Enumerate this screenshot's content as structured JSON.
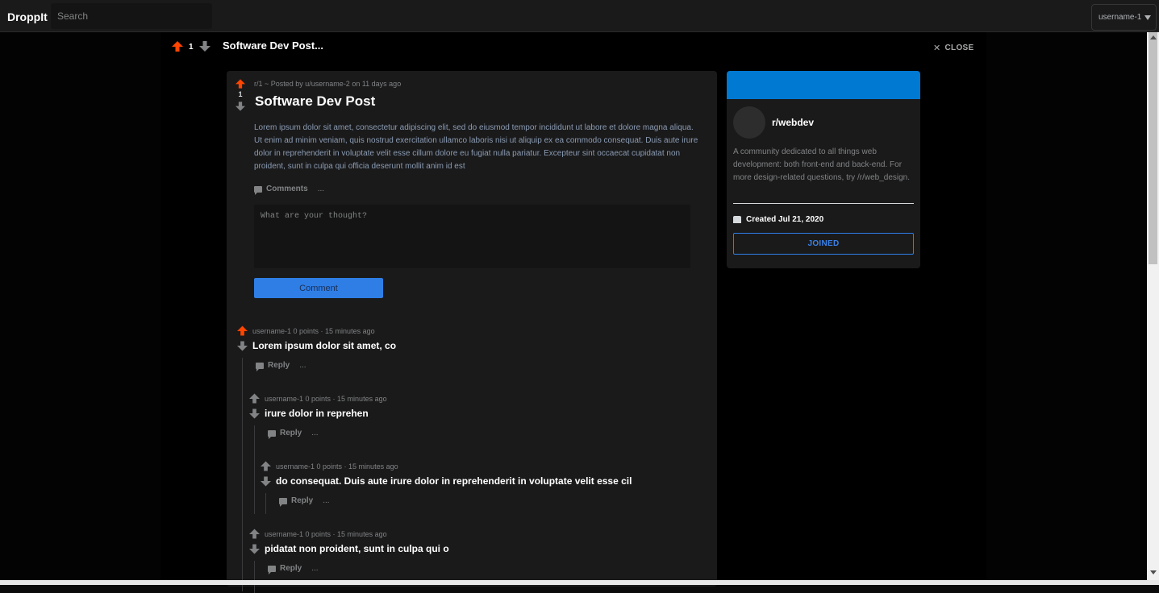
{
  "app": {
    "name": "DroppIt"
  },
  "search": {
    "placeholder": "Search"
  },
  "user_menu": {
    "label": "username-1"
  },
  "modal": {
    "vote_count": "1",
    "title": "Software Dev Post...",
    "close_label": "CLOSE"
  },
  "post": {
    "vote_count": "1",
    "meta": "r/1 ~ Posted by u/username-2 on 11 days ago",
    "title": "Software Dev Post",
    "body": "Lorem ipsum dolor sit amet, consectetur adipiscing elit, sed do eiusmod tempor incididunt ut labore et dolore magna aliqua. Ut enim ad minim veniam, quis nostrud exercitation ullamco laboris nisi ut aliquip ex ea commodo consequat. Duis aute irure dolor in reprehenderit in voluptate velit esse cillum dolore eu fugiat nulla pariatur. Excepteur sint occaecat cupidatat non proident, sunt in culpa qui officia deserunt mollit anim id est",
    "comments_label": "Comments",
    "more_label": "...",
    "comment_placeholder": "What are your thought?",
    "comment_button": "Comment"
  },
  "comments": [
    {
      "meta": "username-1 0 points · 15 minutes ago",
      "text": "Lorem ipsum dolor sit amet, co",
      "reply": "Reply",
      "more": "...",
      "upvoted": true
    },
    {
      "meta": "username-1 0 points · 15 minutes ago",
      "text": "irure dolor in reprehen",
      "reply": "Reply",
      "more": "...",
      "upvoted": false
    },
    {
      "meta": "username-1 0 points · 15 minutes ago",
      "text": "do consequat. Duis aute irure dolor in reprehenderit in voluptate velit esse cil",
      "reply": "Reply",
      "more": "...",
      "upvoted": false
    },
    {
      "meta": "username-1 0 points · 15 minutes ago",
      "text": "pidatat non proident, sunt in culpa qui o",
      "reply": "Reply",
      "more": "...",
      "upvoted": false
    }
  ],
  "sidebar": {
    "community_name": "r/webdev",
    "description": "A community dedicated to all things web development: both front-end and back-end. For more design-related questions, try /r/web_design.",
    "created": "Created Jul 21, 2020",
    "joined_label": "JOINED"
  },
  "colors": {
    "upvote_active": "#ff4500",
    "vote_inactive": "#818384",
    "accent_blue": "#0079d3",
    "button_blue": "#2f7ee6"
  }
}
